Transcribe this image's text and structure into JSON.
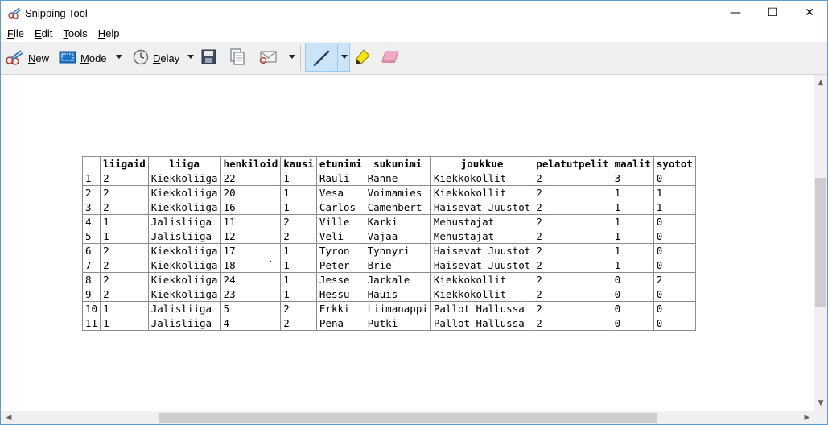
{
  "window": {
    "title": "Snipping Tool",
    "minimize_glyph": "—",
    "maximize_glyph": "☐",
    "close_glyph": "✕"
  },
  "menu": [
    "File",
    "Edit",
    "Tools",
    "Help"
  ],
  "toolbar": {
    "new_label": "New",
    "mode_label": "Mode",
    "delay_label": "Delay",
    "icons": [
      "snip-icon",
      "mode-icon",
      "clock-icon",
      "save-icon",
      "copy-icon",
      "send-email-icon",
      "pen-icon",
      "highlighter-icon",
      "eraser-icon"
    ],
    "active_tool": "pen"
  },
  "table": {
    "columns": [
      "",
      "liigaid",
      "liiga",
      "henkiloid",
      "kausi",
      "etunimi",
      "sukunimi",
      "joukkue",
      "pelatutpelit",
      "maalit",
      "syotot"
    ],
    "rows": [
      [
        "1",
        "2",
        "Kiekkoliiga",
        "22",
        "1",
        "Rauli",
        "Ranne",
        "Kiekkokollit",
        "2",
        "3",
        "0"
      ],
      [
        "2",
        "2",
        "Kiekkoliiga",
        "20",
        "1",
        "Vesa",
        "Voimamies",
        "Kiekkokollit",
        "2",
        "1",
        "1"
      ],
      [
        "3",
        "2",
        "Kiekkoliiga",
        "16",
        "1",
        "Carlos",
        "Camenbert",
        "Haisevat Juustot",
        "2",
        "1",
        "1"
      ],
      [
        "4",
        "1",
        "Jalisliiga",
        "11",
        "2",
        "Ville",
        "Karki",
        "Mehustajat",
        "2",
        "1",
        "0"
      ],
      [
        "5",
        "1",
        "Jalisliiga",
        "12",
        "2",
        "Veli",
        "Vajaa",
        "Mehustajat",
        "2",
        "1",
        "0"
      ],
      [
        "6",
        "2",
        "Kiekkoliiga",
        "17",
        "1",
        "Tyron",
        "Tynnyri",
        "Haisevat Juustot",
        "2",
        "1",
        "0"
      ],
      [
        "7",
        "2",
        "Kiekkoliiga",
        "18",
        "1",
        "Peter",
        "Brie",
        "Haisevat Juustot",
        "2",
        "1",
        "0"
      ],
      [
        "8",
        "2",
        "Kiekkoliiga",
        "24",
        "1",
        "Jesse",
        "Jarkale",
        "Kiekkokollit",
        "2",
        "0",
        "2"
      ],
      [
        "9",
        "2",
        "Kiekkoliiga",
        "23",
        "1",
        "Hessu",
        "Hauis",
        "Kiekkokollit",
        "2",
        "0",
        "0"
      ],
      [
        "10",
        "1",
        "Jalisliiga",
        "5",
        "2",
        "Erkki",
        "Liimanappi",
        "Pallot Hallussa",
        "2",
        "0",
        "0"
      ],
      [
        "11",
        "1",
        "Jalisliiga",
        "4",
        "2",
        "Pena",
        "Putki",
        "Pallot Hallussa",
        "2",
        "0",
        "0"
      ]
    ]
  },
  "scrollbars": {
    "up_glyph": "▲",
    "down_glyph": "▼",
    "left_glyph": "◀",
    "right_glyph": "▶"
  },
  "colors": {
    "accent_border": "#5a9bd5",
    "active_tool_bg": "#cce4f7",
    "toolbar_bg": "#f0f0f0"
  }
}
